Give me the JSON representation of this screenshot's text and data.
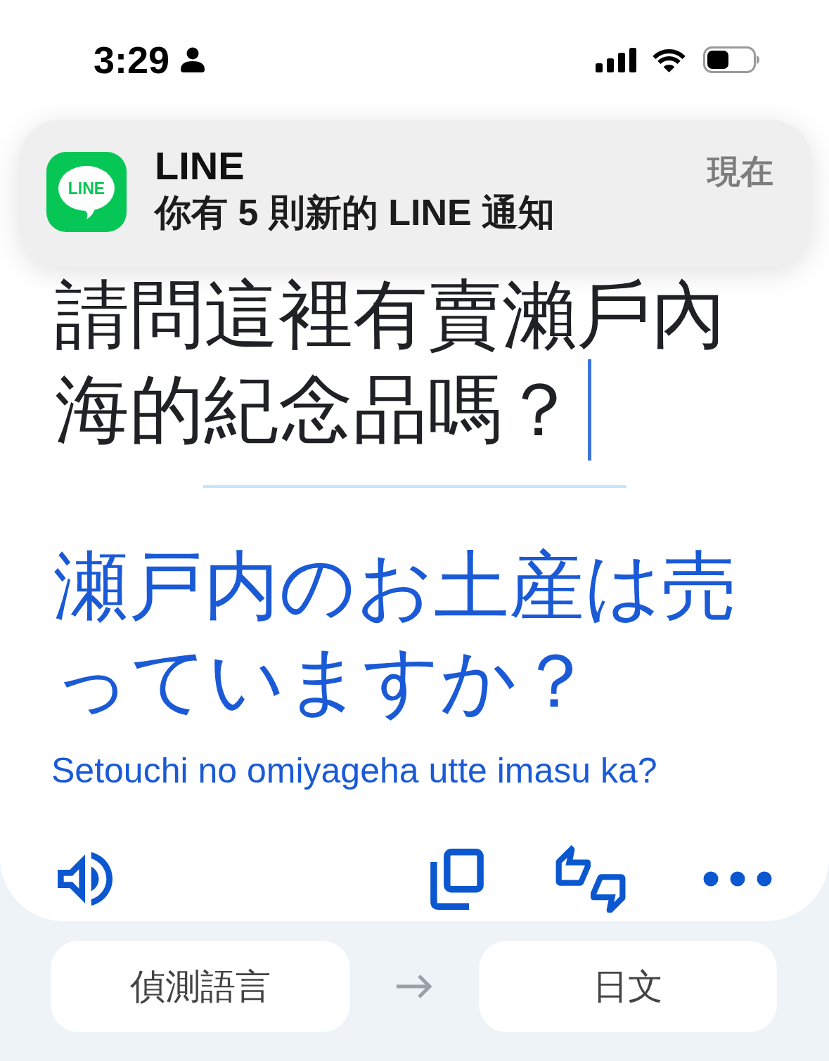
{
  "status_bar": {
    "time": "3:29"
  },
  "notification": {
    "icon_label": "LINE",
    "app_name": "LINE",
    "message": "你有 5 則新的 LINE 通知",
    "time": "現在"
  },
  "source": {
    "text": "請問這裡有賣瀨戶內海的紀念品嗎？"
  },
  "translation": {
    "text": "瀬戸内のお土産は売っていますか？",
    "romanization": "Setouchi no omiyageha utte imasu ka?"
  },
  "languages": {
    "source": "偵測語言",
    "target": "日文"
  }
}
